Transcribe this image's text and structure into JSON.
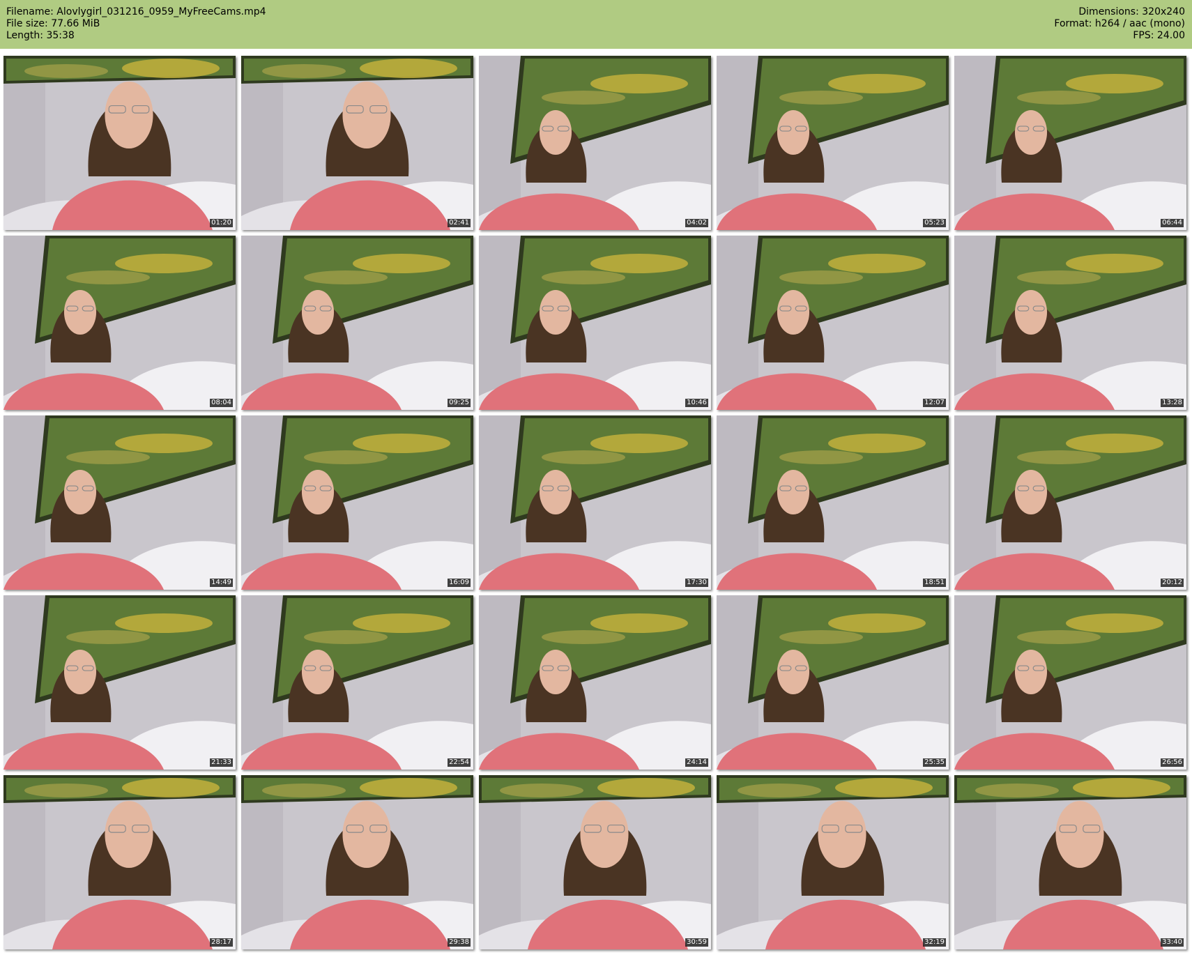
{
  "header": {
    "filename_line": "Filename: Alovlygirl_031216_0959_MyFreeCams.mp4",
    "filesize_line": "File size: 77.66 MiB",
    "length_line": "Length: 35:38",
    "dimensions_line": "Dimensions: 320x240",
    "format_line": "Format: h264 / aac (mono)",
    "fps_line": "FPS: 24.00"
  },
  "colors": {
    "header_background": "#b0cb82",
    "timestamp_background": "#191919",
    "wall": "#c9c6cc",
    "sweater": "#e0727a",
    "hair": "#4a3423",
    "painting_frame": "#2f3a1f"
  },
  "thumbnails": [
    {
      "timestamp": "01:20",
      "icon": "video-frame"
    },
    {
      "timestamp": "02:41",
      "icon": "video-frame"
    },
    {
      "timestamp": "04:02",
      "icon": "video-frame"
    },
    {
      "timestamp": "05:23",
      "icon": "video-frame"
    },
    {
      "timestamp": "06:44",
      "icon": "video-frame"
    },
    {
      "timestamp": "08:04",
      "icon": "video-frame"
    },
    {
      "timestamp": "09:25",
      "icon": "video-frame"
    },
    {
      "timestamp": "10:46",
      "icon": "video-frame"
    },
    {
      "timestamp": "12:07",
      "icon": "video-frame"
    },
    {
      "timestamp": "13:28",
      "icon": "video-frame"
    },
    {
      "timestamp": "14:49",
      "icon": "video-frame"
    },
    {
      "timestamp": "16:09",
      "icon": "video-frame"
    },
    {
      "timestamp": "17:30",
      "icon": "video-frame"
    },
    {
      "timestamp": "18:51",
      "icon": "video-frame"
    },
    {
      "timestamp": "20:12",
      "icon": "video-frame"
    },
    {
      "timestamp": "21:33",
      "icon": "video-frame"
    },
    {
      "timestamp": "22:54",
      "icon": "video-frame"
    },
    {
      "timestamp": "24:14",
      "icon": "video-frame"
    },
    {
      "timestamp": "25:35",
      "icon": "video-frame"
    },
    {
      "timestamp": "26:56",
      "icon": "video-frame"
    },
    {
      "timestamp": "28:17",
      "icon": "video-frame"
    },
    {
      "timestamp": "29:38",
      "icon": "video-frame"
    },
    {
      "timestamp": "30:59",
      "icon": "video-frame"
    },
    {
      "timestamp": "32:19",
      "icon": "video-frame"
    },
    {
      "timestamp": "33:40",
      "icon": "video-frame"
    }
  ]
}
